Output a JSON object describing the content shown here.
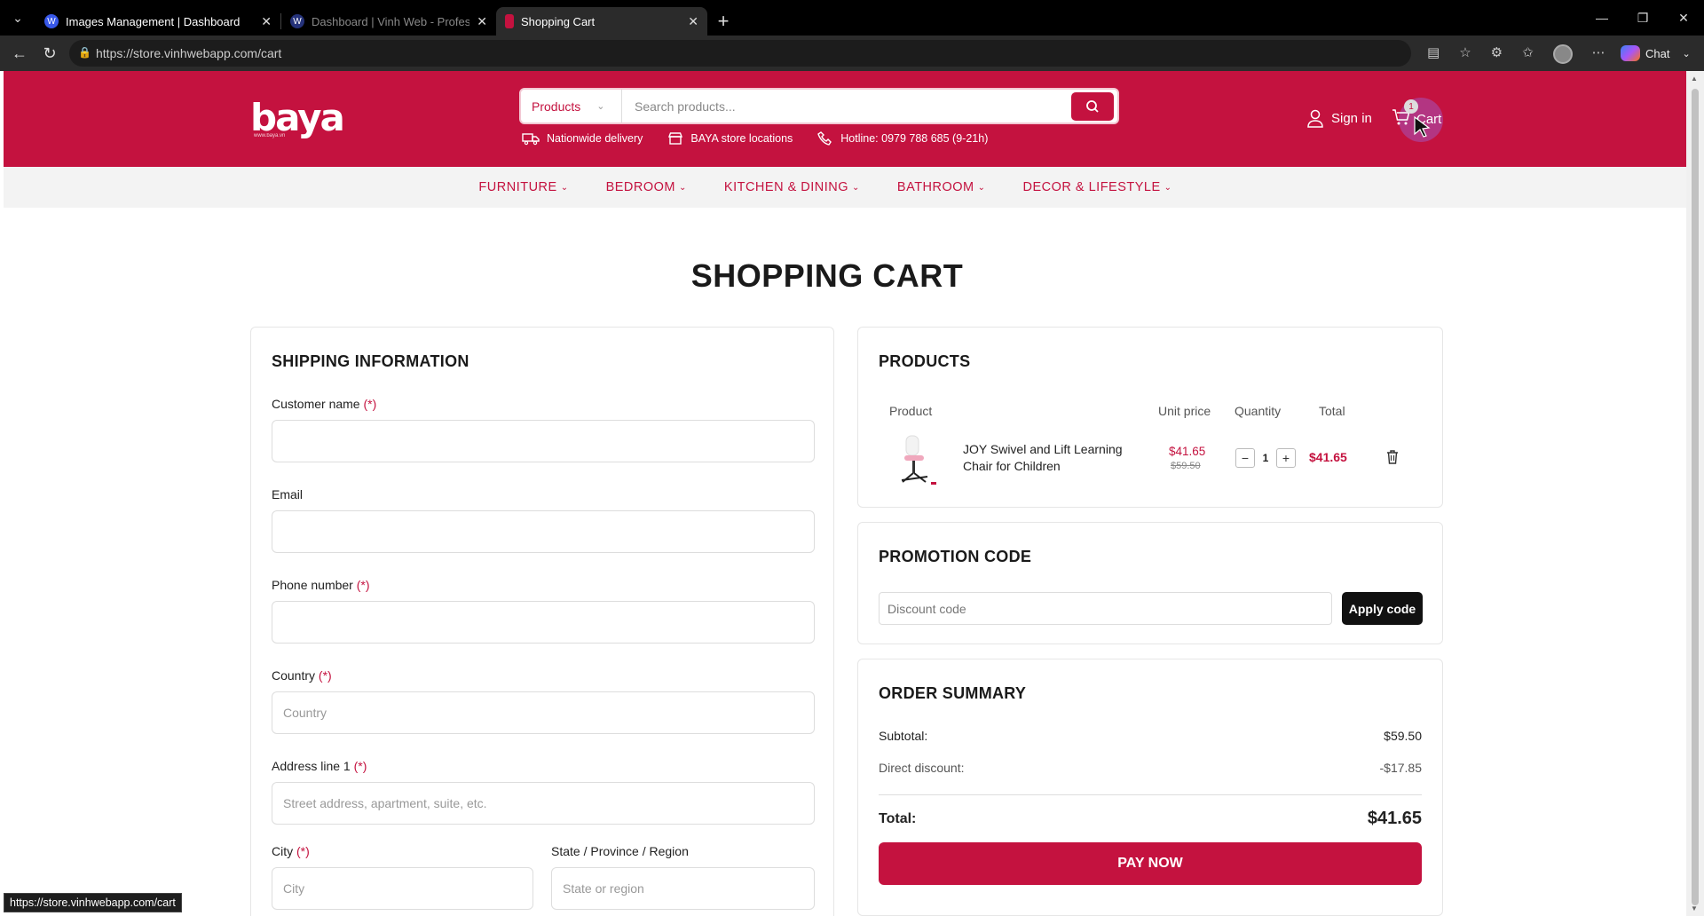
{
  "browser": {
    "tabs": [
      {
        "title": "Images Management | Dashboard"
      },
      {
        "title": "Dashboard | Vinh Web - Professio"
      },
      {
        "title": "Shopping Cart"
      }
    ],
    "url": "https://store.vinhwebapp.com/cart",
    "chat_label": "Chat",
    "status_url": "https://store.vinhwebapp.com/cart"
  },
  "header": {
    "logo": "baya",
    "logo_sub": "www.baya.vn",
    "search_category": "Products",
    "search_placeholder": "Search products...",
    "info": [
      {
        "label": "Nationwide delivery"
      },
      {
        "label": "BAYA store locations"
      },
      {
        "label": "Hotline: 0979 788 685 (9-21h)"
      }
    ],
    "sign_in": "Sign in",
    "cart_label": "Cart",
    "cart_count": "1"
  },
  "nav": [
    {
      "label": "FURNITURE"
    },
    {
      "label": "BEDROOM"
    },
    {
      "label": "KITCHEN & DINING"
    },
    {
      "label": "BATHROOM"
    },
    {
      "label": "DECOR & LIFESTYLE"
    }
  ],
  "page_title": "SHOPPING CART",
  "shipping": {
    "title": "SHIPPING INFORMATION",
    "required_mark": "(*)",
    "customer_name_label": "Customer name",
    "email_label": "Email",
    "phone_label": "Phone number",
    "country_label": "Country",
    "country_placeholder": "Country",
    "address_label": "Address line 1",
    "address_placeholder": "Street address, apartment, suite, etc.",
    "city_label": "City",
    "city_placeholder": "City",
    "state_label": "State / Province / Region",
    "state_placeholder": "State or region"
  },
  "products": {
    "title": "PRODUCTS",
    "headers": {
      "product": "Product",
      "unit_price": "Unit price",
      "quantity": "Quantity",
      "total": "Total"
    },
    "items": [
      {
        "name": "JOY Swivel and Lift Learning Chair for Children",
        "price": "$41.65",
        "old_price": "$59.50",
        "quantity": "1",
        "total": "$41.65"
      }
    ]
  },
  "promotion": {
    "title": "PROMOTION CODE",
    "placeholder": "Discount code",
    "apply_label": "Apply code"
  },
  "summary": {
    "title": "ORDER SUMMARY",
    "subtotal_label": "Subtotal:",
    "subtotal_value": "$59.50",
    "discount_label": "Direct discount:",
    "discount_value": "-$17.85",
    "total_label": "Total:",
    "total_value": "$41.65",
    "pay_label": "PAY NOW"
  },
  "colors": {
    "brand": "#c4123f",
    "dark_button": "#111111"
  }
}
